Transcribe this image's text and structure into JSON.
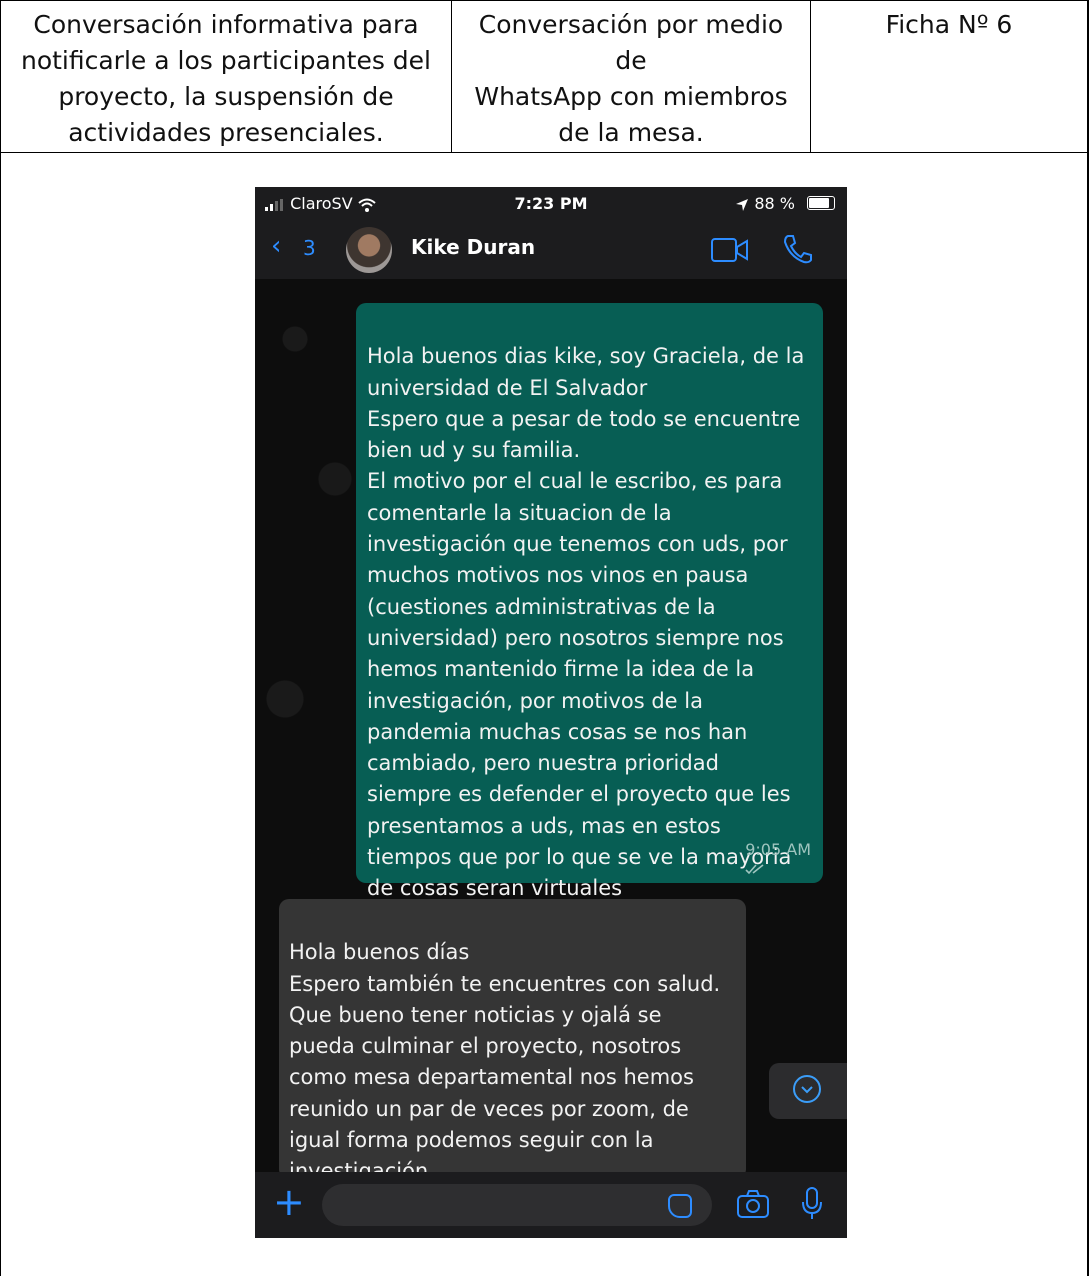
{
  "table": {
    "cell1": "Conversación informativa para\nnotificarle a los participantes del\nproyecto, la suspensión de\nactividades presenciales.",
    "cell2": "Conversación por medio de\nWhatsApp con miembros\nde la mesa.",
    "cell3": "Ficha Nº 6"
  },
  "phone": {
    "status": {
      "carrier": "ClaroSV",
      "time": "7:23 PM",
      "battery": "88 %"
    },
    "header": {
      "back_count": "3",
      "contact_name": "Kike Duran"
    },
    "messages": [
      {
        "direction": "outgoing",
        "text": "Hola buenos dias kike, soy Graciela, de la\nuniversidad de El Salvador\nEspero que a pesar de todo se encuentre\nbien ud y su familia.\nEl motivo por el cual le escribo, es para\ncomentarle la situacion de la\ninvestigación que tenemos con uds, por\nmuchos motivos nos vinos en pausa\n(cuestiones administrativas de la\nuniversidad) pero nosotros siempre nos\nhemos mantenido firme la idea de la\ninvestigación, por motivos de la\npandemia muchas cosas se nos han\ncambiado, pero nuestra prioridad\nsiempre es defender el proyecto que les\npresentamos a uds, mas en estos\ntiempos que por lo que se ve la mayoria\nde cosas seran virtuales",
        "time": "9:05 AM"
      },
      {
        "direction": "incoming",
        "text": "Hola buenos días\nEspero también te encuentres con salud.\nQue bueno tener noticias y ojalá se\npueda culminar el proyecto, nosotros\ncomo mesa departamental nos hemos\nreunido un par de veces por zoom, de\nigual forma podemos seguir con la\ninvestigación.\nSi necesitan convocar una reunión me"
      }
    ],
    "input": {
      "placeholder": ""
    },
    "colors": {
      "outgoing_bubble": "#075e54",
      "incoming_bubble": "#353535",
      "accent": "#2d8cff"
    },
    "icons": [
      "signal-icon",
      "wifi-icon",
      "location-icon",
      "battery-icon",
      "back-chevron-icon",
      "video-call-icon",
      "phone-call-icon",
      "read-receipt-icon",
      "scroll-down-icon",
      "plus-icon",
      "sticker-icon",
      "camera-icon",
      "microphone-icon"
    ]
  }
}
